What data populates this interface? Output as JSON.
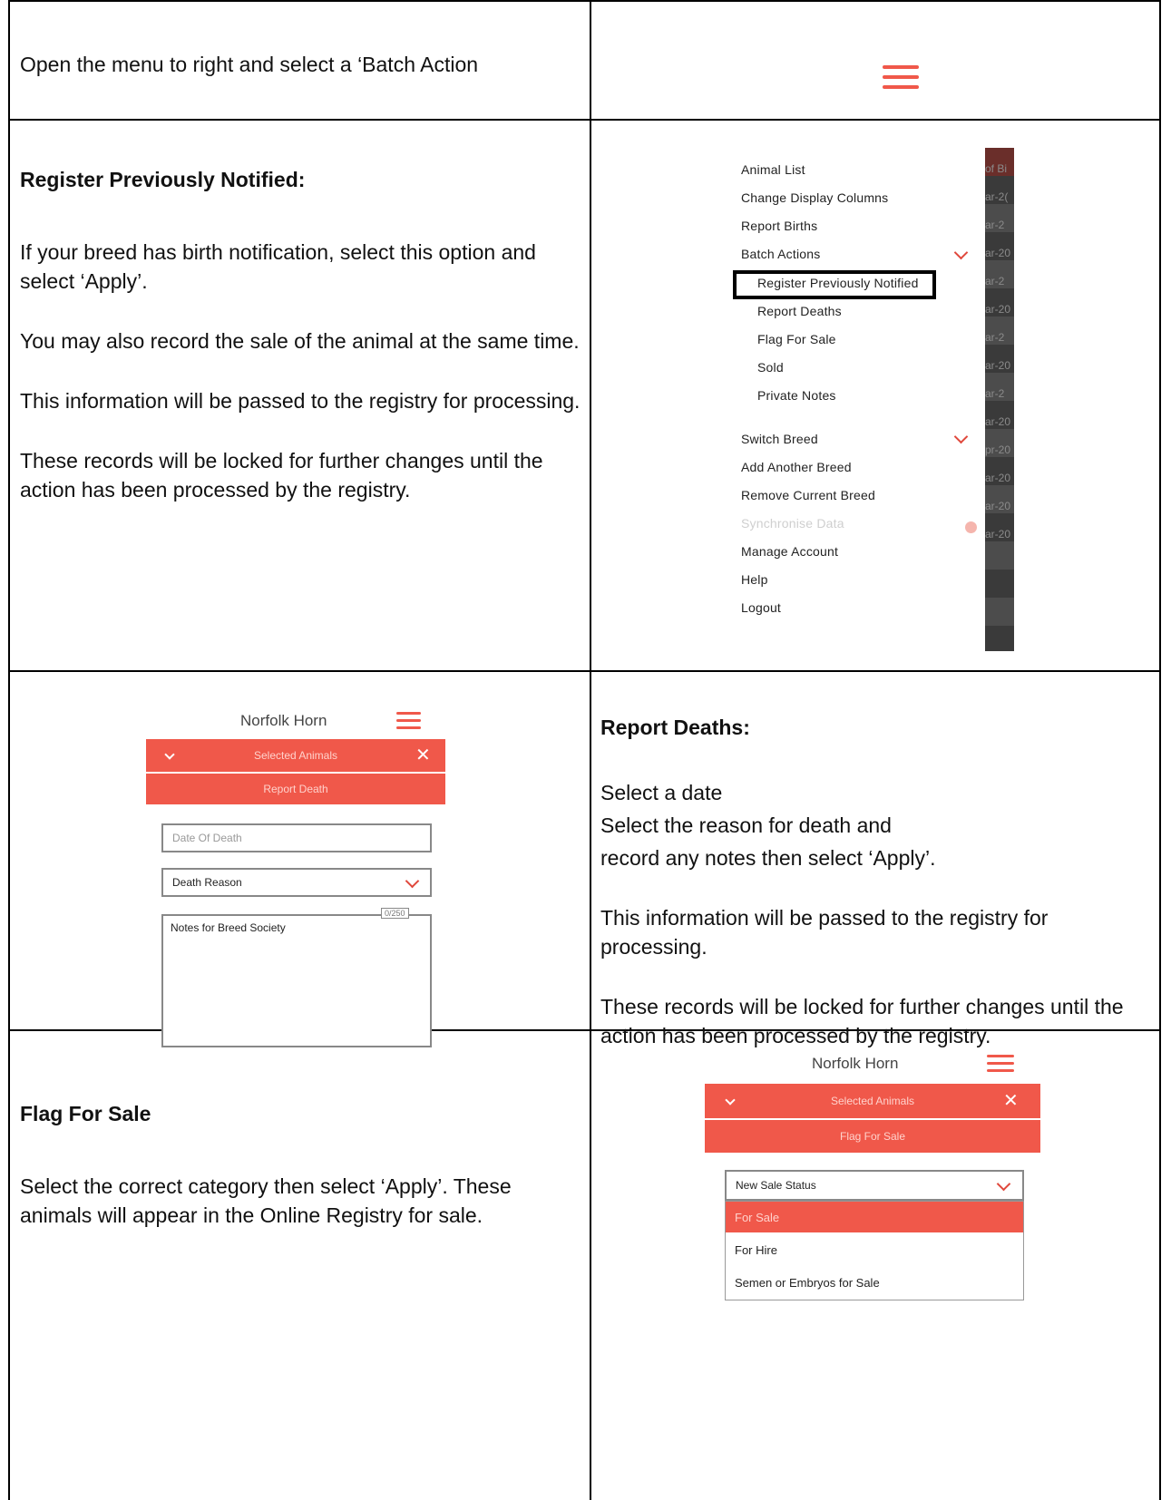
{
  "row1": {
    "instruction": "Open the menu to right and select a ‘Batch Action",
    "menu_icon": "hamburger-menu-icon"
  },
  "row2": {
    "heading": "Register Previously Notified:",
    "para1": "If your breed has birth notification, select this option and select ‘Apply’.",
    "para2": "You may also record the sale of the animal at the same time.",
    "para3": "This information will be passed to the registry for processing.",
    "para4": "These records will be locked for further changes until the action has been processed by the registry.",
    "menu": {
      "items": [
        {
          "label": "Animal List"
        },
        {
          "label": "Change Display Columns"
        },
        {
          "label": "Report Births"
        },
        {
          "label": "Batch Actions"
        },
        {
          "label": "Register Previously Notified"
        },
        {
          "label": "Report Deaths"
        },
        {
          "label": "Flag For Sale"
        },
        {
          "label": "Sold"
        },
        {
          "label": "Private Notes"
        },
        {
          "label": "Switch Breed"
        },
        {
          "label": "Add Another Breed"
        },
        {
          "label": "Remove Current Breed"
        },
        {
          "label": "Synchronise Data"
        },
        {
          "label": "Manage Account"
        },
        {
          "label": "Help"
        },
        {
          "label": "Logout"
        }
      ],
      "strip_fragments": [
        "of Bi",
        "ar-2(",
        "ar-2",
        "ar-20",
        "ar-2",
        "ar-20",
        "ar-2",
        "ar-20",
        "ar-2",
        "ar-20",
        "pr-20",
        "ar-20",
        "ar-20",
        "ar-20"
      ]
    }
  },
  "row3": {
    "form": {
      "app_title": "Norfolk Horn",
      "selected_animals": "Selected Animals",
      "action": "Report Death",
      "date_placeholder": "Date Of Death",
      "reason_label": "Death Reason",
      "notes_placeholder": "Notes for Breed Society",
      "counter": "0/250"
    },
    "heading": "Report Deaths:",
    "line1": "Select a date",
    "line2": "Select the reason for death and",
    "line3": "record any notes then select ‘Apply’.",
    "para2": "This information will be passed to the registry for processing.",
    "para3": "These records will be locked for further changes until the action has been processed by the registry."
  },
  "row4": {
    "heading": "Flag For Sale",
    "para": "Select the correct category then select ‘Apply’.  These animals will appear in the Online Registry for sale.",
    "form": {
      "app_title": "Norfolk Horn",
      "selected_animals": "Selected Animals",
      "action": "Flag For Sale",
      "status_label": "New Sale Status",
      "options": [
        "For Sale",
        "For Hire",
        "Semen or Embryos for Sale"
      ],
      "selected_option": "For Sale"
    }
  },
  "colors": {
    "accent": "#f0584a",
    "border": "#000000"
  }
}
